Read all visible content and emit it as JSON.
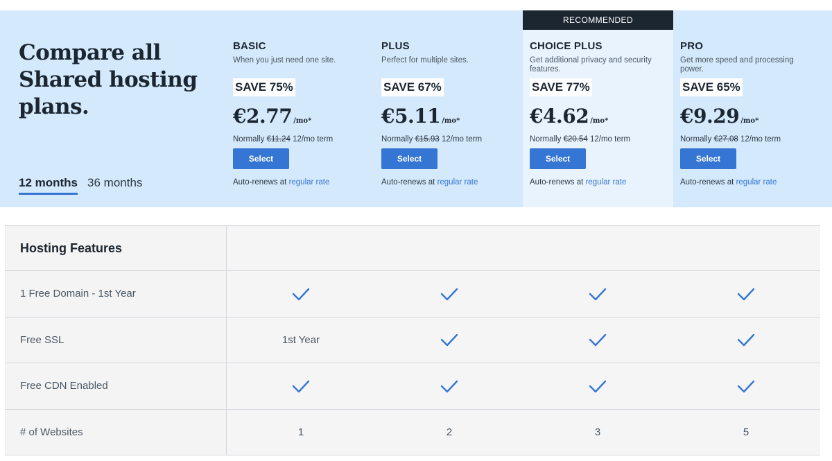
{
  "headline": "Compare all Shared hosting plans.",
  "terms": [
    "12 months",
    "36 months"
  ],
  "recommended_label": "RECOMMENDED",
  "select_label": "Select",
  "renew_text": "Auto-renews at",
  "renew_link": "regular rate",
  "normally_label": "Normally",
  "term_suffix": "12/mo term",
  "per_month": "/mo*",
  "plans": [
    {
      "name": "BASIC",
      "desc": "When you just need one site.",
      "save": "SAVE 75%",
      "price": "€2.77",
      "normal": "€11.24"
    },
    {
      "name": "PLUS",
      "desc": "Perfect for multiple sites.",
      "save": "SAVE 67%",
      "price": "€5.11",
      "normal": "€15.93"
    },
    {
      "name": "CHOICE PLUS",
      "desc": "Get additional privacy and security features.",
      "save": "SAVE 77%",
      "price": "€4.62",
      "normal": "€20.54"
    },
    {
      "name": "PRO",
      "desc": "Get more speed and processing power.",
      "save": "SAVE 65%",
      "price": "€9.29",
      "normal": "€27.08"
    }
  ],
  "features_heading": "Hosting Features",
  "features": [
    {
      "label": "1 Free Domain - 1st Year",
      "values": [
        "check",
        "check",
        "check",
        "check"
      ]
    },
    {
      "label": "Free SSL",
      "values": [
        "1st Year",
        "check",
        "check",
        "check"
      ]
    },
    {
      "label": "Free CDN Enabled",
      "values": [
        "check",
        "check",
        "check",
        "check"
      ]
    },
    {
      "label": "# of Websites",
      "values": [
        "1",
        "2",
        "3",
        "5"
      ]
    }
  ],
  "colors": {
    "accent": "#3575d3",
    "header_bg": "#d4e9fb",
    "highlight_bg": "#e8f3fd",
    "dark": "#1b2631"
  }
}
